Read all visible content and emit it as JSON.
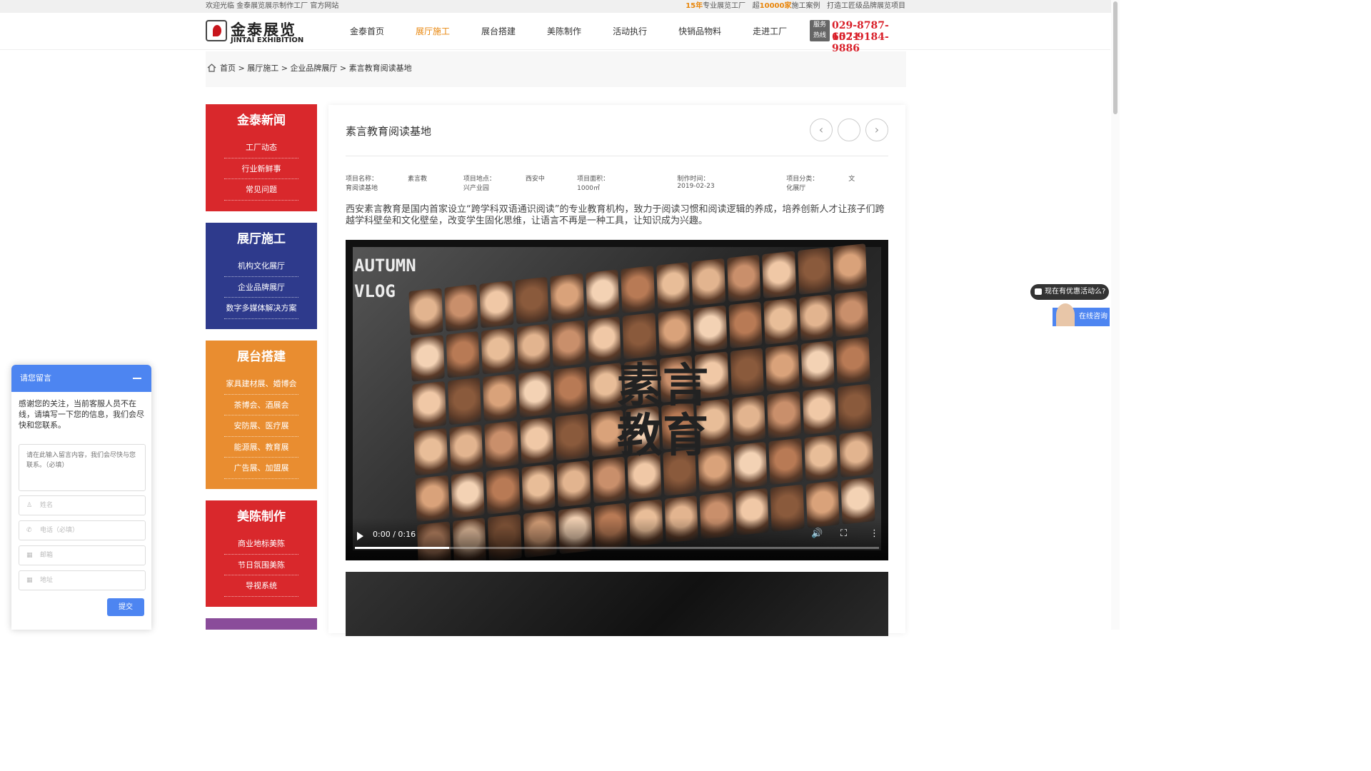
{
  "topbar": {
    "welcome": "欢迎光临 金泰展览展示制作工厂 官方网站",
    "years": "15年",
    "years_suffix": "专业展览工厂",
    "cases_prefix": "超",
    "cases": "10000家",
    "cases_suffix": "施工案例",
    "slogan": "打造工匠级品牌展览项目"
  },
  "logo": {
    "cn": "金泰展览",
    "en": "JINTAI EXHIBITION"
  },
  "nav": [
    "金泰首页",
    "展厅施工",
    "展台搭建",
    "美陈制作",
    "活动执行",
    "快销品物料",
    "走进工厂"
  ],
  "hotline": {
    "label1": "服务",
    "label2": "热线",
    "phone1": "029-8787-6071",
    "phone2": "152-9184-9886"
  },
  "breadcrumb": [
    "首页",
    "展厅施工",
    "企业品牌展厅",
    "素言教育阅读基地"
  ],
  "sidebar": [
    {
      "title": "金泰新闻",
      "items": [
        "工厂动态",
        "行业新鲜事",
        "常见问题"
      ]
    },
    {
      "title": "展厅施工",
      "items": [
        "机构文化展厅",
        "企业品牌展厅",
        "数字多媒体解决方案"
      ]
    },
    {
      "title": "展台搭建",
      "items": [
        "家具建材展、婚博会",
        "茶博会、酒展会",
        "安防展、医疗展",
        "能源展、教育展",
        "广告展、加盟展"
      ]
    },
    {
      "title": "美陈制作",
      "items": [
        "商业地标美陈",
        "节日氛围美陈",
        "导视系统"
      ]
    }
  ],
  "colors": {
    "red": "#d9282c",
    "blue": "#2e3a8c",
    "orange": "#e98d30",
    "accent": "#e8860c",
    "chat": "#4d85f1"
  },
  "project": {
    "title": "素言教育阅读基地",
    "meta": [
      {
        "label": "项目名称：",
        "value": "素言教育阅读基地"
      },
      {
        "label": "项目地点：",
        "value": "西安中兴产业园"
      },
      {
        "label": "项目面积：",
        "value": "1000㎡"
      },
      {
        "label": "制作时间：",
        "value": "2019-02-23"
      },
      {
        "label": "项目分类：",
        "value": "文化展厅"
      }
    ],
    "description": "西安素言教育是国内首家设立“跨学科双语通识阅读”的专业教育机构，致力于阅读习惯和阅读逻辑的养成，培养创新人才让孩子们跨越学科壁垒和文化壁垒，改变学生固化思维，让语言不再是一种工具，让知识成为兴趣。",
    "video": {
      "overlay1": "AUTUMN",
      "overlay2": "VLOG",
      "wall_text1": "素言",
      "wall_text2": "教育",
      "time": "0:00 / 0:16",
      "progress": 0.18
    }
  },
  "chat": {
    "title": "请您留言",
    "message": "感谢您的关注，当前客服人员不在线，请填写一下您的信息，我们会尽快和您联系。",
    "textarea_placeholder": "请在此输入留言内容，我们会尽快与您联系。（必填）",
    "name": "姓名",
    "phone": "电话（必填）",
    "email": "邮箱",
    "address": "地址",
    "submit": "提交"
  },
  "float": {
    "promo": "现在有优惠活动么?",
    "online": "在线咨询"
  }
}
